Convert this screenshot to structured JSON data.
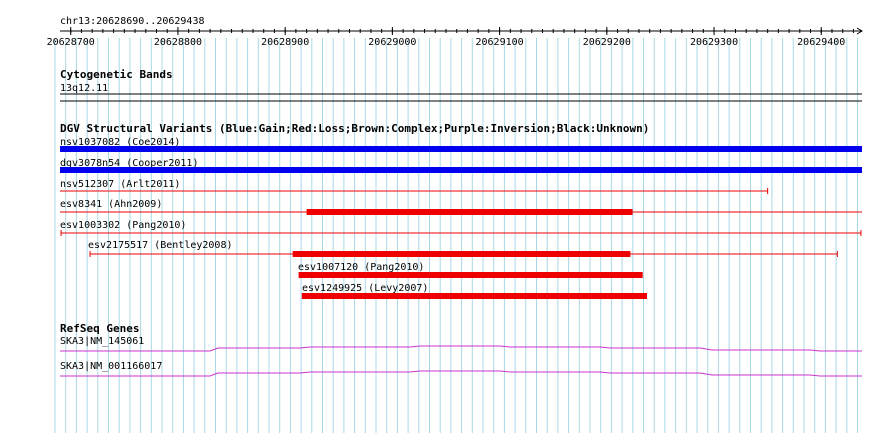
{
  "ruler": {
    "region": "chr13:20628690..20629438",
    "start": 20628690,
    "end": 20629438,
    "ticks": [
      "20628700",
      "20628800",
      "20628900",
      "20629000",
      "20629100",
      "20629200",
      "20629300",
      "20629400"
    ]
  },
  "cyto": {
    "title": "Cytogenetic Bands",
    "band": "13q12.11"
  },
  "dgv": {
    "title": "DGV Structural Variants (Blue:Gain;Red:Loss;Brown:Complex;Purple:Inversion;Black:Unknown)",
    "variants": [
      {
        "label": "nsv1037082 (Coe2014)",
        "type": "gain",
        "color": "#0000ee",
        "start": 20628690,
        "end": 20629438,
        "thick_start": 20628690,
        "thick_end": 20629438,
        "extends_left": true,
        "extends_right": true
      },
      {
        "label": "dgv3078n54 (Cooper2011)",
        "type": "gain",
        "color": "#0000ee",
        "start": 20628690,
        "end": 20629438,
        "thick_start": 20628690,
        "thick_end": 20629438,
        "extends_left": true,
        "extends_right": true
      },
      {
        "label": "nsv512307 (Arlt2011)",
        "type": "loss",
        "color": "#ee0000",
        "start": 20628690,
        "end": 20629350,
        "thick_start": null,
        "thick_end": null,
        "extends_left": true,
        "extends_right": false
      },
      {
        "label": "esv8341 (Ahn2009)",
        "type": "loss",
        "color": "#ee0000",
        "start": 20628690,
        "end": 20629438,
        "thick_start": 20628920,
        "thick_end": 20629224,
        "extends_left": true,
        "extends_right": true
      },
      {
        "label": "esv1003302 (Pang2010)",
        "type": "loss",
        "color": "#ee0000",
        "start": 20628691,
        "end": 20629437,
        "thick_start": null,
        "thick_end": null,
        "extends_left": false,
        "extends_right": false
      },
      {
        "label": "esv2175517 (Bentley2008)",
        "type": "loss",
        "color": "#ee0000",
        "start": 20628718,
        "end": 20629415,
        "thick_start": 20628907,
        "thick_end": 20629222,
        "extends_left": false,
        "extends_right": false
      },
      {
        "label": "esv1007120 (Pang2010)",
        "type": "loss",
        "color": "#ee0000",
        "start": 20628913,
        "end": 20629233,
        "thick_start": 20628913,
        "thick_end": 20629233,
        "extends_left": false,
        "extends_right": false
      },
      {
        "label": "esv1249925 (Levy2007)",
        "type": "loss",
        "color": "#ee0000",
        "start": 20628916,
        "end": 20629237,
        "thick_start": 20628916,
        "thick_end": 20629237,
        "extends_left": false,
        "extends_right": false
      }
    ]
  },
  "refseq": {
    "title": "RefSeq Genes",
    "color": "#cc33cc",
    "genes": [
      {
        "label": "SKA3|NM_145061"
      },
      {
        "label": "SKA3|NM_001166017"
      }
    ]
  },
  "colors": {
    "grid": "#a8d8e8",
    "text": "#000000"
  }
}
